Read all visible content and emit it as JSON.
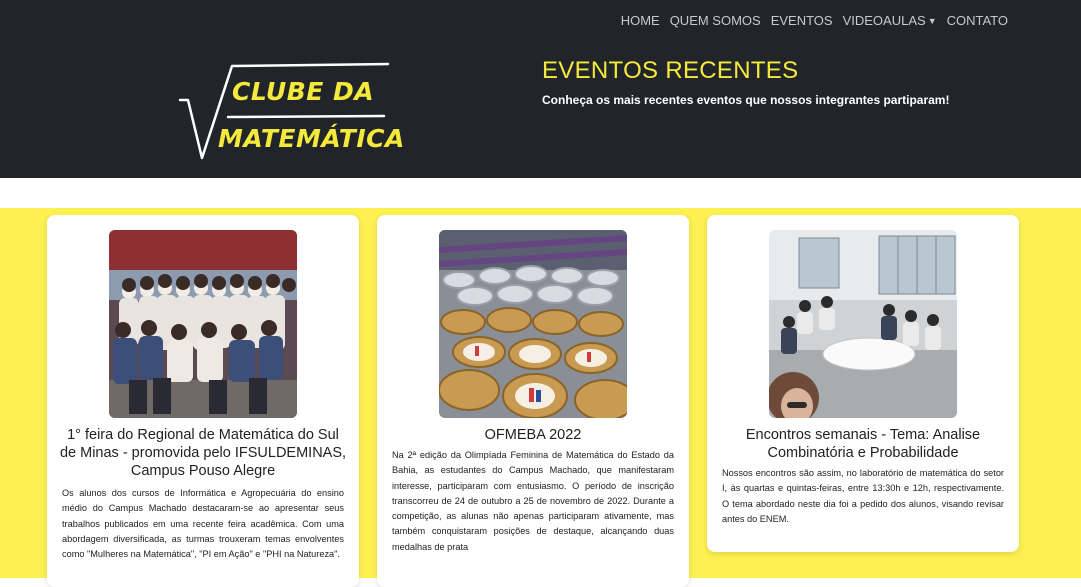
{
  "nav": {
    "items": [
      {
        "label": "HOME"
      },
      {
        "label": "QUEM SOMOS"
      },
      {
        "label": "EVENTOS"
      },
      {
        "label": "VIDEOAULAS",
        "dropdown": true
      },
      {
        "label": "CONTATO"
      }
    ]
  },
  "logo": {
    "line1": "CLUBE DA",
    "line2": "MATEMÁTICA"
  },
  "hero": {
    "title": "EVENTOS RECENTES",
    "subtitle": "Conheça os mais recentes eventos que nossos integrantes partiparam!"
  },
  "events": [
    {
      "title": "1° feira do Regional de Matemática do Sul de Minas - promovida pelo IFSULDEMINAS, Campus Pouso Alegre",
      "text": "Os alunos dos cursos de Informática e Agropecuária do ensino médio do Campus Machado destacaram-se ao apresentar seus trabalhos publicados em uma recente feira acadêmica. Com uma abordagem diversificada, as turmas trouxeram temas envolventes como \"Mulheres na Matemática\", \"PI em Ação\" e \"PHI na Natureza\"."
    },
    {
      "title": "OFMEBA 2022",
      "text": "Na 2ª edição da Olimpíada Feminina de Matemática do Estado da Bahia, as estudantes do Campus Machado, que manifestaram interesse, participaram com entusiasmo. O período de inscrição transcorreu de 24 de outubro a 25 de novembro de 2022. Durante a competição, as alunas não apenas participaram ativamente, mas também conquistaram posições de destaque, alcançando duas medalhas de prata"
    },
    {
      "title": "Encontros semanais - Tema: Analise Combinatória e Probabilidade",
      "text": "Nossos encontros são assim, no laboratório de matemática do setor I, às quartas e quintas-feiras, entre 13:30h e 12h, respectivamente. O tema abordado neste dia foi a pedido dos alunos, visando revisar antes do ENEM."
    }
  ],
  "colors": {
    "header_bg": "#212529",
    "accent_yellow": "#f5ea3c",
    "section_bg": "#fdf051",
    "nav_text": "#c8c9cc"
  }
}
